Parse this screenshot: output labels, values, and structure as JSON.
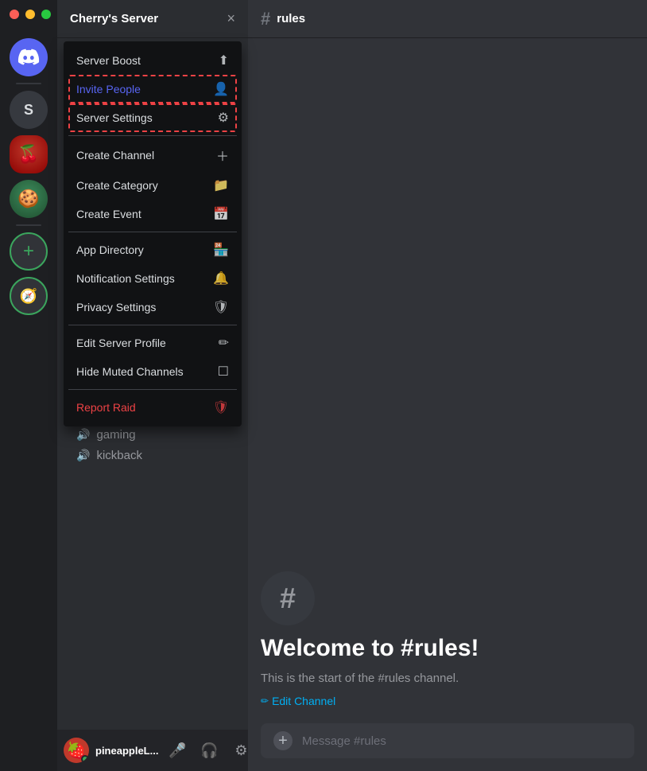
{
  "window": {
    "title": "Cherry's Server",
    "close_label": "×"
  },
  "traffic_lights": {
    "close_color": "#ff5f57",
    "min_color": "#ffbd2e",
    "max_color": "#28c840"
  },
  "server_sidebar": {
    "icons": [
      {
        "id": "discord-home",
        "label": "Discord Home",
        "symbol": "⬡",
        "type": "discord"
      },
      {
        "id": "s-server",
        "label": "S Server",
        "symbol": "S",
        "type": "text"
      },
      {
        "id": "cherry-server",
        "label": "Cherry's Server",
        "symbol": "🍒",
        "type": "emoji",
        "active": true
      },
      {
        "id": "cookie-server",
        "label": "Cookie Server",
        "symbol": "🍪",
        "type": "emoji"
      }
    ],
    "add_server_label": "+",
    "explore_label": "🧭"
  },
  "channel_sidebar": {
    "server_name": "Cherry's Server",
    "voice_channels": [
      {
        "name": "gaming"
      },
      {
        "name": "kickback"
      }
    ]
  },
  "dropdown_menu": {
    "items": [
      {
        "id": "server-boost",
        "label": "Server Boost",
        "icon": "⬆",
        "color": "normal",
        "highlighted": false
      },
      {
        "id": "invite-people",
        "label": "Invite People",
        "icon": "👤+",
        "color": "blue",
        "highlighted": true
      },
      {
        "id": "server-settings",
        "label": "Server Settings",
        "icon": "⚙",
        "color": "normal",
        "highlighted": true
      },
      {
        "id": "create-channel",
        "label": "Create Channel",
        "icon": "＋",
        "color": "normal",
        "highlighted": false
      },
      {
        "id": "create-category",
        "label": "Create Category",
        "icon": "📁",
        "color": "normal",
        "highlighted": false
      },
      {
        "id": "create-event",
        "label": "Create Event",
        "icon": "📅",
        "color": "normal",
        "highlighted": false
      },
      {
        "id": "app-directory",
        "label": "App Directory",
        "icon": "🏪",
        "color": "normal",
        "highlighted": false
      },
      {
        "id": "notification-settings",
        "label": "Notification Settings",
        "icon": "🔔",
        "color": "normal",
        "highlighted": false
      },
      {
        "id": "privacy-settings",
        "label": "Privacy Settings",
        "icon": "🛡",
        "color": "normal",
        "highlighted": false
      },
      {
        "id": "edit-server-profile",
        "label": "Edit Server Profile",
        "icon": "✏",
        "color": "normal",
        "highlighted": false
      },
      {
        "id": "hide-muted-channels",
        "label": "Hide Muted Channels",
        "icon": "☐",
        "color": "normal",
        "highlighted": false
      },
      {
        "id": "report-raid",
        "label": "Report Raid",
        "icon": "🛡",
        "color": "red",
        "highlighted": false
      }
    ]
  },
  "channel_header": {
    "hash": "#",
    "channel_name": "rules"
  },
  "chat": {
    "welcome_icon": "#",
    "welcome_title": "Welcome to #rules!",
    "welcome_text": "This is the start of the #rules channel.",
    "edit_channel_label": "Edit Channel",
    "edit_icon": "✏"
  },
  "message_input": {
    "placeholder": "Message #rules",
    "add_icon": "+"
  },
  "user_area": {
    "username": "pineappleL...",
    "mic_icon": "🎤",
    "headphone_icon": "🎧",
    "settings_icon": "⚙"
  }
}
